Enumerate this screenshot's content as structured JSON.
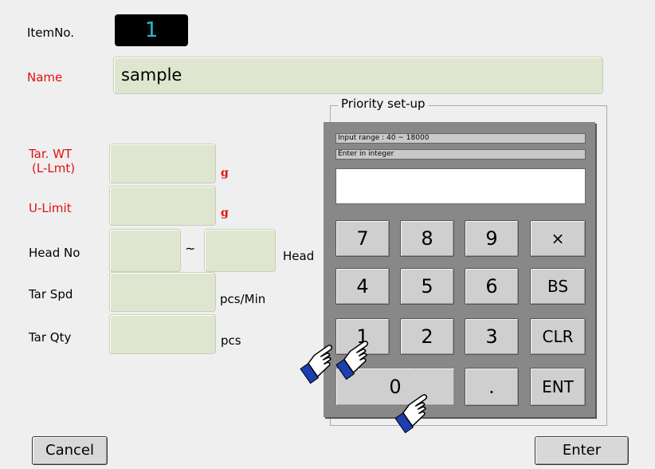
{
  "item": {
    "label": "ItemNo.",
    "value": "1"
  },
  "name": {
    "label": "Name",
    "value": "sample"
  },
  "fields": {
    "tar_wt": {
      "label_line1": "Tar. WT",
      "label_line2": "(L-Lmt)",
      "unit": "g"
    },
    "u_limit": {
      "label": "U-Limit",
      "unit": "g"
    },
    "head_no": {
      "label": "Head No",
      "separator": "~",
      "unit": "Head"
    },
    "tar_spd": {
      "label": "Tar Spd",
      "unit": "pcs/Min"
    },
    "tar_qty": {
      "label": "Tar Qty",
      "unit": "pcs"
    }
  },
  "priority": {
    "legend": "Priority set-up"
  },
  "keypad": {
    "input_range": "Input range :  40 ~ 18000",
    "hint": "Enter in integer",
    "display_value": "",
    "keys": {
      "k7": "7",
      "k8": "8",
      "k9": "9",
      "mul": "×",
      "k4": "4",
      "k5": "5",
      "k6": "6",
      "bs": "BS",
      "k1": "1",
      "k2": "2",
      "k3": "3",
      "clr": "CLR",
      "k0": "0",
      "dot": ".",
      "ent": "ENT"
    }
  },
  "buttons": {
    "cancel": "Cancel",
    "enter": "Enter"
  },
  "icons": [
    "pointing-hand-icon"
  ],
  "colors": {
    "label_red": "#e01010",
    "field_bg": "#dfe6cf",
    "keypad_bg": "#888888",
    "item_no_text": "#2fb8d8"
  }
}
